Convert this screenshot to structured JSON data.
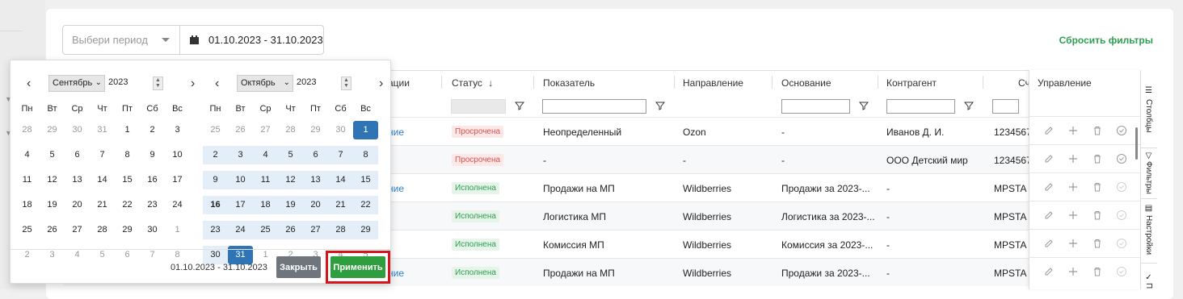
{
  "filters": {
    "period_placeholder": "Выбери период",
    "date_range": "01.10.2023 - 31.10.2023",
    "reset_label": "Сбросить фильтры"
  },
  "table": {
    "columns": [
      "ации",
      "Статус",
      "Показатель",
      "Направление",
      "Основание",
      "Контрагент",
      "Сч"
    ],
    "status_sort_arrow": "↓",
    "rows": [
      {
        "op": "ние",
        "status": "Просрочена",
        "status_type": "overdue",
        "metric": "Неопределенный",
        "direction": "Ozon",
        "basis": "-",
        "counterparty": "Иванов Д. И.",
        "account": "1234567"
      },
      {
        "op": "",
        "status": "Просрочена",
        "status_type": "overdue",
        "metric": "-",
        "direction": "-",
        "basis": "-",
        "counterparty": "ООО Детский мир",
        "account": "1234567"
      },
      {
        "op": "ние",
        "status": "Исполнена",
        "status_type": "done",
        "metric": "Продажи на МП",
        "direction": "Wildberries",
        "basis": "Продажи за 2023-...",
        "counterparty": "-",
        "account": "MPSTA"
      },
      {
        "op": "",
        "status": "Исполнена",
        "status_type": "done",
        "metric": "Логистика МП",
        "direction": "Wildberries",
        "basis": "Логистика за 2023-...",
        "counterparty": "-",
        "account": "MPSTA"
      },
      {
        "op": "",
        "status": "Исполнена",
        "status_type": "done",
        "metric": "Комиссия МП",
        "direction": "Wildberries",
        "basis": "Комиссия за 2023-...",
        "counterparty": "-",
        "account": "MPSTA"
      },
      {
        "op": "ние",
        "status": "Исполнена",
        "status_type": "done",
        "metric": "Продажи на МП",
        "direction": "Wildberries",
        "basis": "Продажи за 2023-...",
        "counterparty": "-",
        "account": "MPSTA"
      }
    ]
  },
  "management": {
    "header": "Управление",
    "actions": [
      "edit-icon",
      "plus-icon",
      "trash-icon",
      "check-circle-icon"
    ]
  },
  "side_tabs": [
    "Столбцы",
    "Фильтры",
    "Настройки",
    "П"
  ],
  "calendar": {
    "weekdays": [
      "Пн",
      "Вт",
      "Ср",
      "Чт",
      "Пт",
      "Сб",
      "Вс"
    ],
    "months": [
      {
        "month": "Сентябрь",
        "year": "2023",
        "days": [
          [
            "28",
            "29",
            "30",
            "31",
            "1",
            "2",
            "3"
          ],
          [
            "4",
            "5",
            "6",
            "7",
            "8",
            "9",
            "10"
          ],
          [
            "11",
            "12",
            "13",
            "14",
            "15",
            "16",
            "17"
          ],
          [
            "18",
            "19",
            "20",
            "21",
            "22",
            "23",
            "24"
          ],
          [
            "25",
            "26",
            "27",
            "28",
            "29",
            "30",
            "1"
          ],
          [
            "2",
            "3",
            "4",
            "5",
            "6",
            "7",
            "8"
          ]
        ]
      },
      {
        "month": "Октябрь",
        "year": "2023",
        "days": [
          [
            "25",
            "26",
            "27",
            "28",
            "29",
            "30",
            "1"
          ],
          [
            "2",
            "3",
            "4",
            "5",
            "6",
            "7",
            "8"
          ],
          [
            "9",
            "10",
            "11",
            "12",
            "13",
            "14",
            "15"
          ],
          [
            "16",
            "17",
            "18",
            "19",
            "20",
            "21",
            "22"
          ],
          [
            "23",
            "24",
            "25",
            "26",
            "27",
            "28",
            "29"
          ],
          [
            "30",
            "31",
            "1",
            "2",
            "3",
            "4",
            "5"
          ]
        ]
      }
    ],
    "selected_range": "01.10.2023 - 31.10.2023",
    "close_label": "Закрыть",
    "apply_label": "Применить",
    "prev_symbol": "‹",
    "next_symbol": "›"
  },
  "colors": {
    "accent_green": "#2e9e3f",
    "selected_blue": "#2f74b5",
    "range_blue": "#e3eef8",
    "highlight_red": "#d4161c"
  }
}
